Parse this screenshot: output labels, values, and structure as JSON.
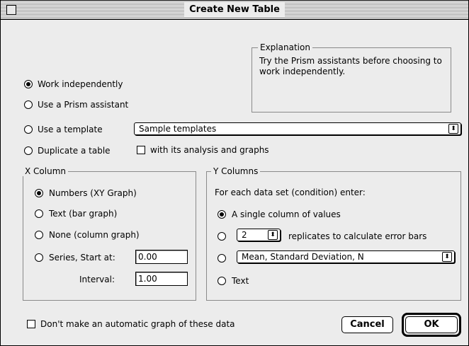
{
  "window": {
    "title": "Create New Table"
  },
  "explanation": {
    "legend": "Explanation",
    "text": "Try the Prism assistants before choosing to work independently."
  },
  "modes": {
    "work_independently": "Work independently",
    "use_assistant": "Use a Prism assistant",
    "use_template": "Use a template",
    "duplicate_table": "Duplicate a table",
    "template_popup_value": "Sample templates",
    "with_analysis_label": "with its analysis and graphs",
    "selected": "work_independently"
  },
  "x_column": {
    "legend": "X Column",
    "options": [
      "Numbers (XY Graph)",
      "Text (bar graph)",
      "None (column graph)",
      "Series, Start at:"
    ],
    "selected": 0,
    "start_value": "0.00",
    "interval_label": "Interval:",
    "interval_value": "1.00"
  },
  "y_columns": {
    "legend": "Y Columns",
    "intro": "For each data set (condition) enter:",
    "single_column": "A single column of values",
    "replicates_value": "2",
    "replicates_label": "replicates to calculate error bars",
    "mean_popup_value": "Mean, Standard Deviation, N",
    "text_option": "Text",
    "selected": "single_column"
  },
  "footer": {
    "no_graph_label": "Don't make an automatic graph of these data",
    "cancel_label": "Cancel",
    "ok_label": "OK"
  },
  "icons": {
    "popup_arrow": "up-down-arrows-icon"
  }
}
